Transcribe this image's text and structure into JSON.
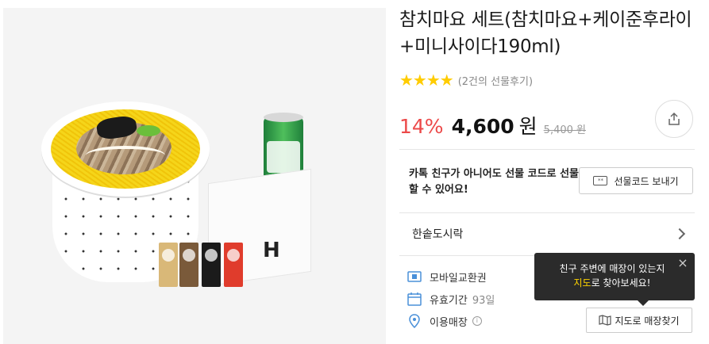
{
  "product": {
    "title": "참치마요 세트(참치마요+케이준후라이+미니사이다190ml)",
    "stars": "★★★★",
    "rating": 4,
    "review_text": "(2건의 선물후기)",
    "discount": "14%",
    "price": "4,600",
    "currency": "원",
    "original_price": "5,400 원"
  },
  "gift": {
    "message": "카톡 친구가 아니어도 선물 코드로 선물 할 수 있어요!",
    "button_label": "선물코드 보내기",
    "button_icon": "gift-code-icon"
  },
  "brand": {
    "name": "한솥도시락"
  },
  "info": {
    "type_label": "모바일교환권",
    "validity_label": "유효기간",
    "validity_value": "93일",
    "store_label": "이용매장"
  },
  "tooltip": {
    "line1": "친구 주변에 매장이 있는지",
    "highlight": "지도",
    "line2_rest": "로 찾아보세요!"
  },
  "map_button": {
    "label": "지도로 매장찾기"
  },
  "colors": {
    "discount": "#ec4949",
    "star": "#ffcc00",
    "tooltip_bg": "#2b2b2b",
    "tooltip_highlight": "#ffd400"
  }
}
